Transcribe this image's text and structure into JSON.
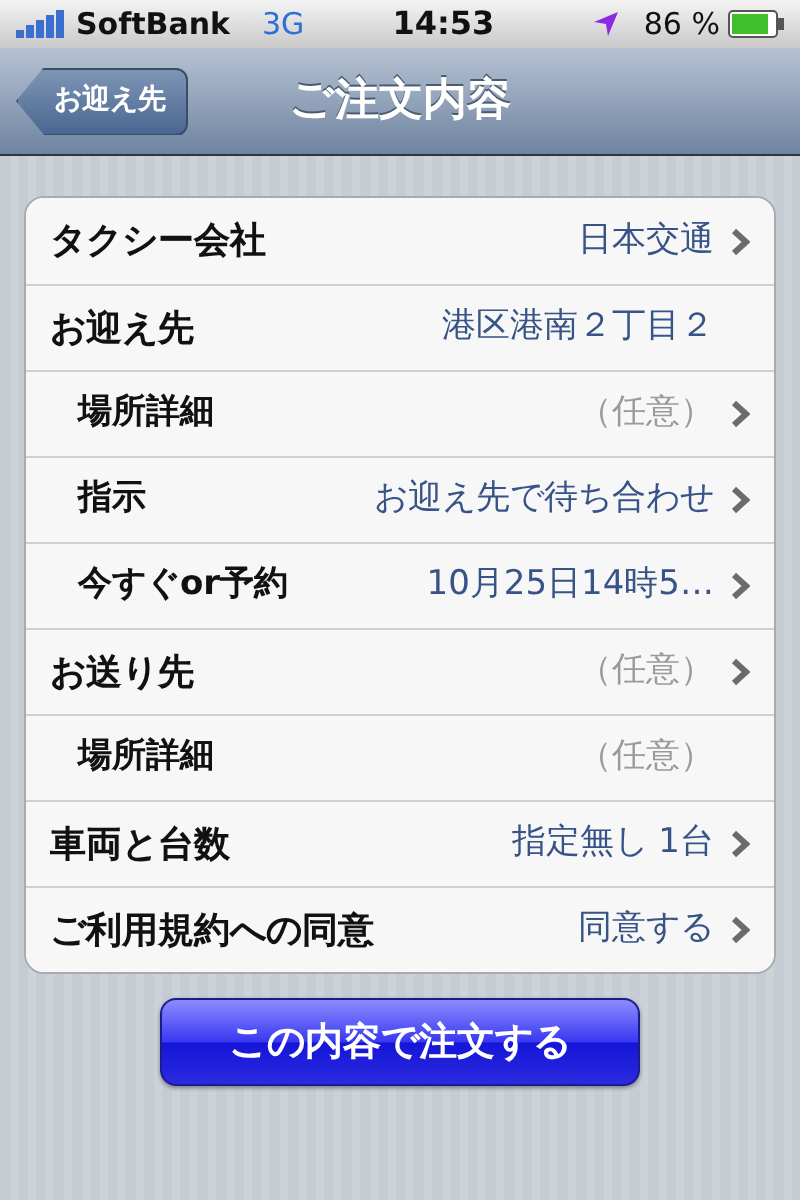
{
  "status_bar": {
    "carrier": "SoftBank",
    "network": "3G",
    "time": "14:53",
    "battery": "86 %"
  },
  "nav_bar": {
    "back_button": "お迎え先",
    "title": "ご注文内容"
  },
  "rows": [
    {
      "kind": "main",
      "label": "タクシー会社",
      "value": "日本交通",
      "muted": false,
      "chevron": true
    },
    {
      "kind": "main",
      "label": "お迎え先",
      "value": "港区港南２丁目２",
      "muted": false,
      "chevron": false
    },
    {
      "kind": "sub",
      "label": "場所詳細",
      "value": "（任意）",
      "muted": true,
      "chevron": true
    },
    {
      "kind": "sub",
      "label": "指示",
      "value": "お迎え先で待ち合わせ",
      "muted": false,
      "chevron": true
    },
    {
      "kind": "sub",
      "label": "今すぐor予約",
      "value": "10月25日14時5…",
      "muted": false,
      "chevron": true
    },
    {
      "kind": "main",
      "label": "お送り先",
      "value": "（任意）",
      "muted": true,
      "chevron": true
    },
    {
      "kind": "sub",
      "label": "場所詳細",
      "value": "（任意）",
      "muted": true,
      "chevron": false
    },
    {
      "kind": "main",
      "label": "車両と台数",
      "value": "指定無し 1台",
      "muted": false,
      "chevron": true
    },
    {
      "kind": "main",
      "label": "ご利用規約への同意",
      "value": "同意する",
      "muted": false,
      "chevron": true
    }
  ],
  "submit_button": "この内容で注文する"
}
